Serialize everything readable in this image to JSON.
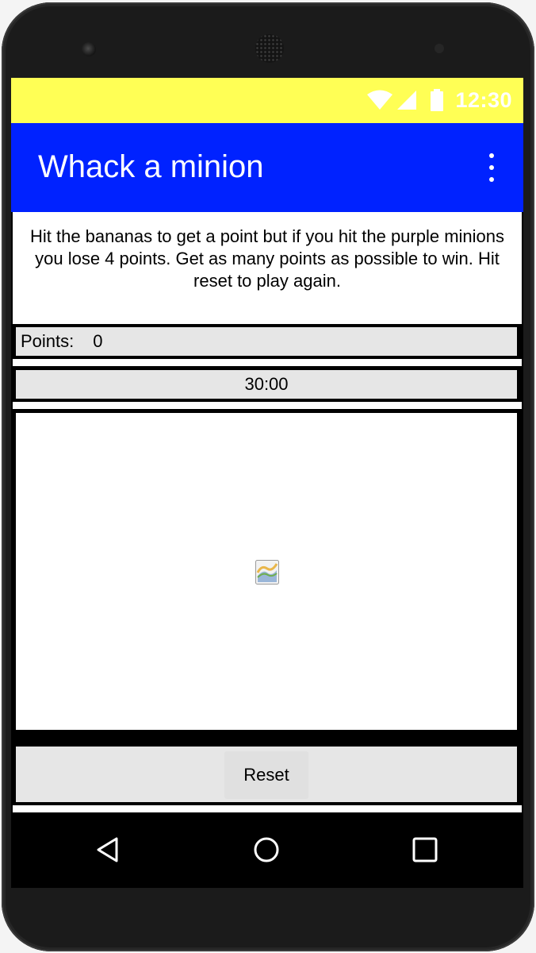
{
  "status_bar": {
    "time": "12:30",
    "icons": [
      "wifi-icon",
      "cell-signal-icon",
      "battery-icon"
    ],
    "color": "#ffff55"
  },
  "app_bar": {
    "title": "Whack a minion",
    "color": "#0022ff",
    "menu_icon": "more-vert-icon"
  },
  "instructions": "Hit the bananas to get a point but if you hit the purple minions you lose 4 points. Get as many points as possible to win. Hit reset to play again.",
  "points": {
    "label": "Points:",
    "value": "0"
  },
  "timer": "30:00",
  "game_canvas": {
    "image_icon": "broken-image-icon"
  },
  "reset_button": {
    "label": "Reset"
  },
  "nav_bar": {
    "icons": [
      "back-icon",
      "home-icon",
      "recents-icon"
    ]
  }
}
